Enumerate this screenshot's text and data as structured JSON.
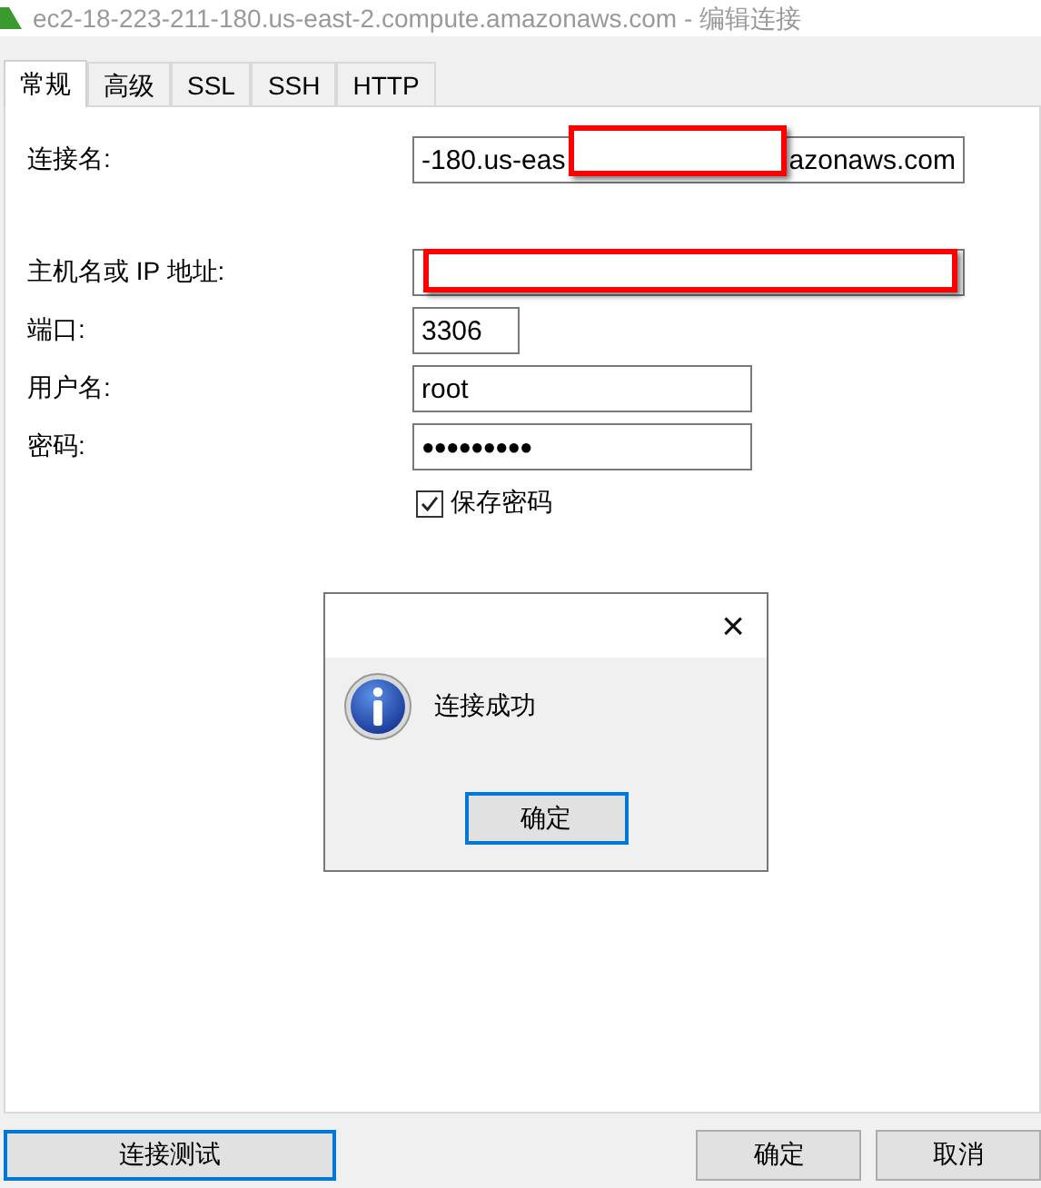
{
  "window": {
    "title": "ec2-18-223-211-180.us-east-2.compute.amazonaws.com - 编辑连接"
  },
  "tabs": [
    {
      "label": "常规",
      "selected": true
    },
    {
      "label": "高级",
      "selected": false
    },
    {
      "label": "SSL",
      "selected": false
    },
    {
      "label": "SSH",
      "selected": false
    },
    {
      "label": "HTTP",
      "selected": false
    }
  ],
  "form": {
    "fields": [
      {
        "kind": "text",
        "label": "连接名:",
        "value_start": "-180.us-eas",
        "value_end": "azonaws.com",
        "redacted": true
      },
      {
        "kind": "text",
        "label": "主机名或 IP 地址:",
        "redacted": true
      },
      {
        "kind": "text",
        "label": "端口:",
        "value_start": "3306",
        "redacted": false
      },
      {
        "kind": "text",
        "label": "用户名:",
        "value_start": "root",
        "redacted": false
      },
      {
        "kind": "password",
        "label": "密码:",
        "value_start": "●●●●●●●●●",
        "redacted": false
      }
    ],
    "save_password": {
      "label": "保存密码",
      "checked": true
    }
  },
  "dialog": {
    "message": "连接成功",
    "ok": "确定",
    "close": "×"
  },
  "buttons": [
    {
      "label": "连接测试",
      "focused": true,
      "kind": "left"
    },
    {
      "label": "确定",
      "focused": false,
      "kind": "right"
    },
    {
      "label": "取消",
      "focused": false,
      "kind": "right"
    }
  ]
}
